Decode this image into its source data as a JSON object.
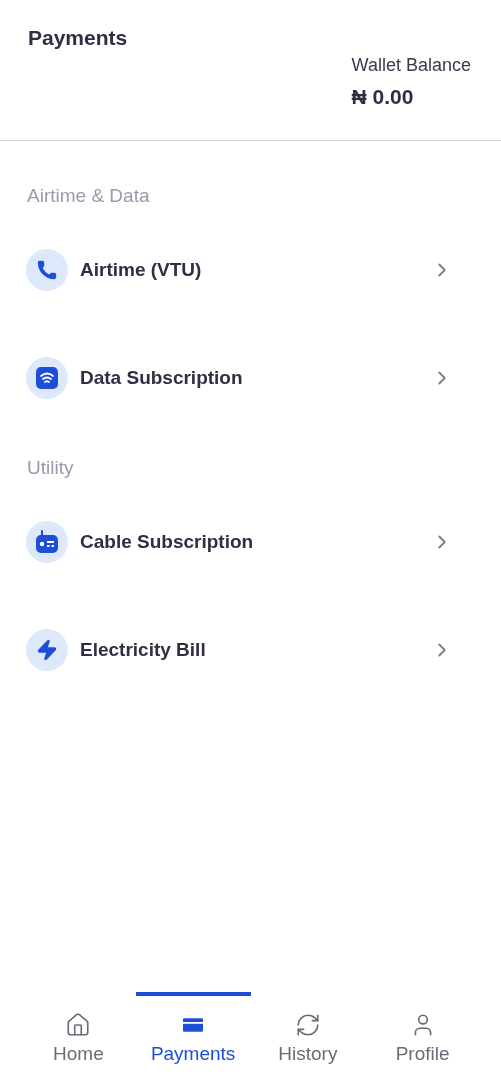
{
  "header": {
    "title": "Payments",
    "wallet_label": "Wallet Balance",
    "wallet_amount": "₦ 0.00"
  },
  "sections": [
    {
      "title": "Airtime & Data",
      "items": [
        {
          "kind": "phone",
          "label": "Airtime (VTU)"
        },
        {
          "kind": "data",
          "label": "Data Subscription"
        }
      ]
    },
    {
      "title": "Utility",
      "items": [
        {
          "kind": "cable",
          "label": "Cable Subscription"
        },
        {
          "kind": "electricity",
          "label": "Electricity Bill"
        }
      ]
    }
  ],
  "nav": [
    {
      "kind": "home",
      "label": "Home",
      "selected": false
    },
    {
      "kind": "payments",
      "label": "Payments",
      "selected": true
    },
    {
      "kind": "history",
      "label": "History",
      "selected": false
    },
    {
      "kind": "profile",
      "label": "Profile",
      "selected": false
    }
  ]
}
